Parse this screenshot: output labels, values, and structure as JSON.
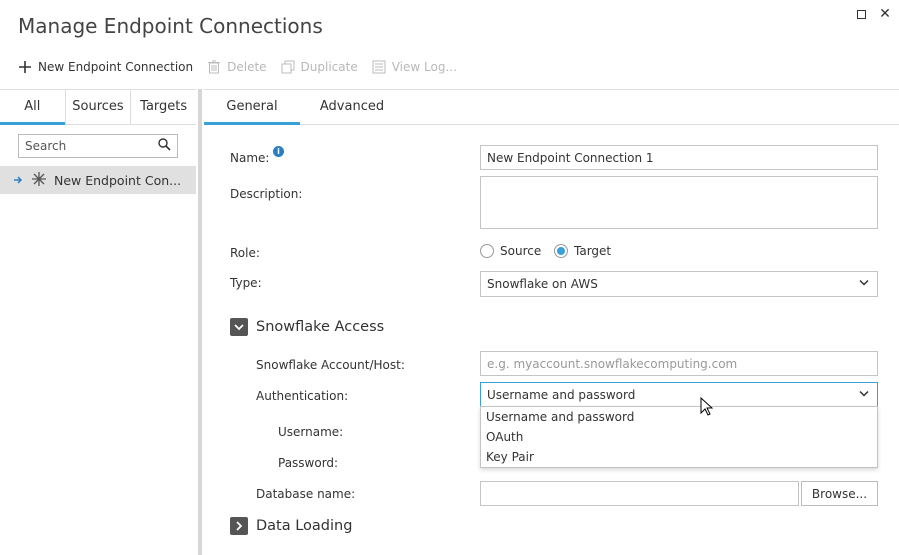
{
  "window": {
    "title": "Manage Endpoint Connections",
    "maximize_icon": "maximize-icon",
    "close_icon": "close-icon"
  },
  "toolbar": {
    "new_label": "New Endpoint Connection",
    "delete_label": "Delete",
    "duplicate_label": "Duplicate",
    "view_log_label": "View Log..."
  },
  "left": {
    "tabs": [
      "All",
      "Sources",
      "Targets"
    ],
    "active_tab": "All",
    "search_placeholder": "Search",
    "items": [
      {
        "label": "New Endpoint Con..."
      }
    ]
  },
  "right": {
    "tabs": [
      "General",
      "Advanced"
    ],
    "active_tab": "General",
    "name_label": "Name:",
    "name_value": "New Endpoint Connection 1",
    "description_label": "Description:",
    "description_value": "",
    "role_label": "Role:",
    "role_options": [
      "Source",
      "Target"
    ],
    "role_selected": "Target",
    "type_label": "Type:",
    "type_value": "Snowflake on AWS",
    "snowflake_section": "Snowflake Access",
    "account_label": "Snowflake Account/Host:",
    "account_placeholder": "e.g. myaccount.snowflakecomputing.com",
    "auth_label": "Authentication:",
    "auth_value": "Username and password",
    "auth_options": [
      "Username and password",
      "OAuth",
      "Key Pair"
    ],
    "username_label": "Username:",
    "password_label": "Password:",
    "database_label": "Database name:",
    "database_value": "",
    "browse_label": "Browse...",
    "data_loading_section": "Data Loading"
  },
  "colors": {
    "accent": "#3aa0d8",
    "list_selected_bg": "#e0e0e0"
  }
}
